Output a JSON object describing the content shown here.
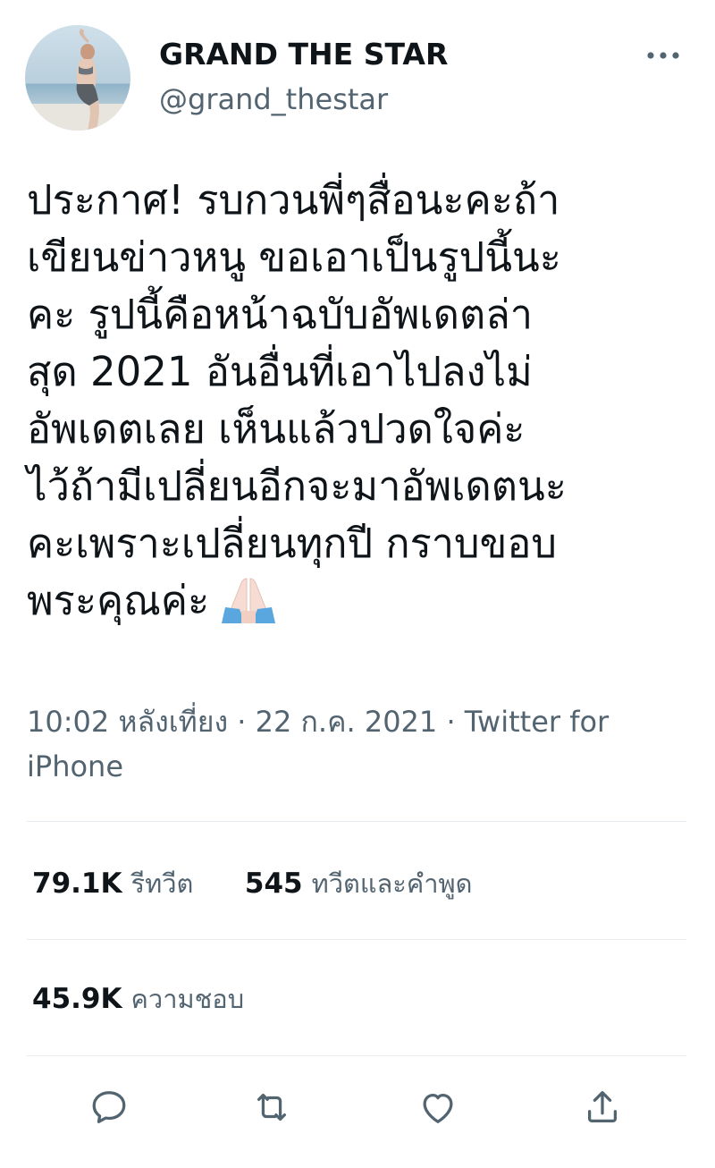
{
  "user": {
    "display_name": "GRAND THE STAR",
    "handle": "@grand_thestar"
  },
  "tweet": {
    "text": "ประกาศ! รบกวนพี่ๆสื่อนะคะถ้า\nเขียนข่าวหนู ขอเอาเป็นรูปนี้นะ\nคะ รูปนี้คือหน้าฉบับอัพเดตล่า\nสุด 2021 อันอื่นที่เอาไปลงไม่\nอัพเดตเลย เห็นแล้วปวดใจค่ะ\nไว้ถ้ามีเปลี่ยนอีกจะมาอัพเดตนะ\nคะเพราะเปลี่ยนทุกปี กราบขอบ\nพระคุณค่ะ",
    "emoji": "folded-hands",
    "time": "10:02 หลังเที่ยง",
    "separator": "·",
    "date": "22 ก.ค. 2021",
    "source": "Twitter for iPhone"
  },
  "stats": {
    "retweets_count": "79.1K",
    "retweets_label": "รีทวีต",
    "quotes_count": "545",
    "quotes_label": "ทวีตและคำพูด",
    "likes_count": "45.9K",
    "likes_label": "ความชอบ"
  },
  "icons": {
    "more": "more-horizontal-icon",
    "reply": "reply-icon",
    "retweet": "retweet-icon",
    "like": "heart-icon",
    "share": "share-icon"
  },
  "colors": {
    "text_primary": "#0f1419",
    "text_secondary": "#536471",
    "divider": "#e6ecf0"
  }
}
